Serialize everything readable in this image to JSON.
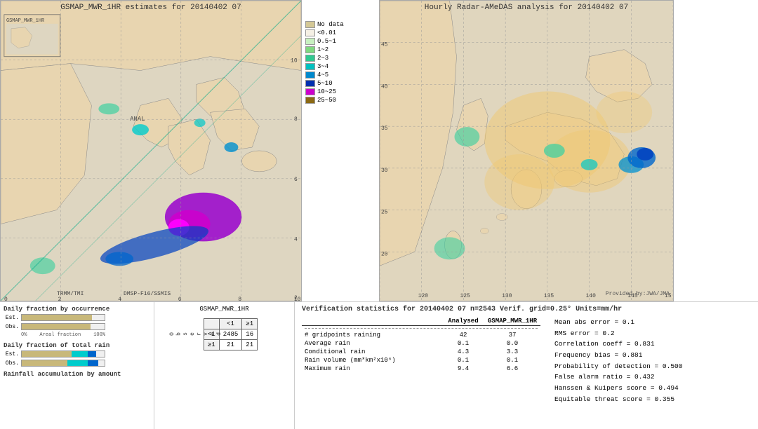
{
  "left_map": {
    "title": "GSMAP_MWR_1HR estimates for 20140402 07",
    "trmm_label": "TRMM/TMI",
    "dmsp_label": "DMSP-F16/SSMIS",
    "anal_label": "ANAL",
    "axes": {
      "x_labels": [
        "0",
        "2",
        "4",
        "6",
        "8",
        "10"
      ],
      "y_labels": [
        "2",
        "4",
        "6",
        "8",
        "10"
      ]
    }
  },
  "right_map": {
    "title": "Hourly Radar-AMeDAS analysis for 20140402 07",
    "provided_by": "Provided by:JWA/JMA",
    "axes": {
      "lat_labels": [
        "20",
        "25",
        "30",
        "35",
        "40",
        "45"
      ],
      "lon_labels": [
        "120",
        "125",
        "130",
        "135",
        "140",
        "145",
        "15"
      ]
    }
  },
  "legend": {
    "title": "",
    "items": [
      {
        "label": "No data",
        "color": "#d4c896"
      },
      {
        "label": "<0.01",
        "color": "#f0ede0"
      },
      {
        "label": "0.5~1",
        "color": "#d4f0d4"
      },
      {
        "label": "1~2",
        "color": "#a0e0a0"
      },
      {
        "label": "2~3",
        "color": "#40d0a0"
      },
      {
        "label": "3~4",
        "color": "#00c8c8"
      },
      {
        "label": "4~5",
        "color": "#0090d0"
      },
      {
        "label": "5~10",
        "color": "#0040c0"
      },
      {
        "label": "10~25",
        "color": "#c000c0"
      },
      {
        "label": "25~50",
        "color": "#8b6914"
      }
    ]
  },
  "bottom": {
    "bar_section1_title": "Daily fraction by occurrence",
    "bar_est_label": "Est.",
    "bar_obs_label": "Obs.",
    "bar_axis_left": "0%",
    "bar_axis_mid": "Areal fraction",
    "bar_axis_right": "100%",
    "bar_section2_title": "Daily fraction of total rain",
    "bar_section3_title": "Rainfall accumulation by amount",
    "gsmap_header": "GSMAP_MWR_1HR",
    "cont_col_lt1": "<1",
    "cont_col_ge1": "≥1",
    "cont_row_lt1": "<1",
    "cont_row_ge1": "≥1",
    "cont_val_2485": "2485",
    "cont_val_16": "16",
    "cont_val_21a": "21",
    "cont_val_21b": "21",
    "obs_label": "O\nb\ns\ne\nr\nv\ne\nd",
    "verif_title": "Verification statistics for 20140402 07  n=2543  Verif. grid=0.25°  Units=mm/hr",
    "verif_headers": [
      "",
      "Analysed",
      "GSMAP_MWR_1HR"
    ],
    "verif_rows": [
      {
        "label": "# gridpoints raining",
        "analysed": "42",
        "gsmap": "37"
      },
      {
        "label": "Average rain",
        "analysed": "0.1",
        "gsmap": "0.0"
      },
      {
        "label": "Conditional rain",
        "analysed": "4.3",
        "gsmap": "3.3"
      },
      {
        "label": "Rain volume (mm*km²x10⁶)",
        "analysed": "0.1",
        "gsmap": "0.1"
      },
      {
        "label": "Maximum rain",
        "analysed": "9.4",
        "gsmap": "6.6"
      }
    ],
    "stats": [
      "Mean abs error = 0.1",
      "RMS error = 0.2",
      "Correlation coeff = 0.831",
      "Frequency bias = 0.881",
      "Probability of detection = 0.500",
      "False alarm ratio = 0.432",
      "Hanssen & Kuipers score = 0.494",
      "Equitable threat score = 0.355"
    ]
  }
}
